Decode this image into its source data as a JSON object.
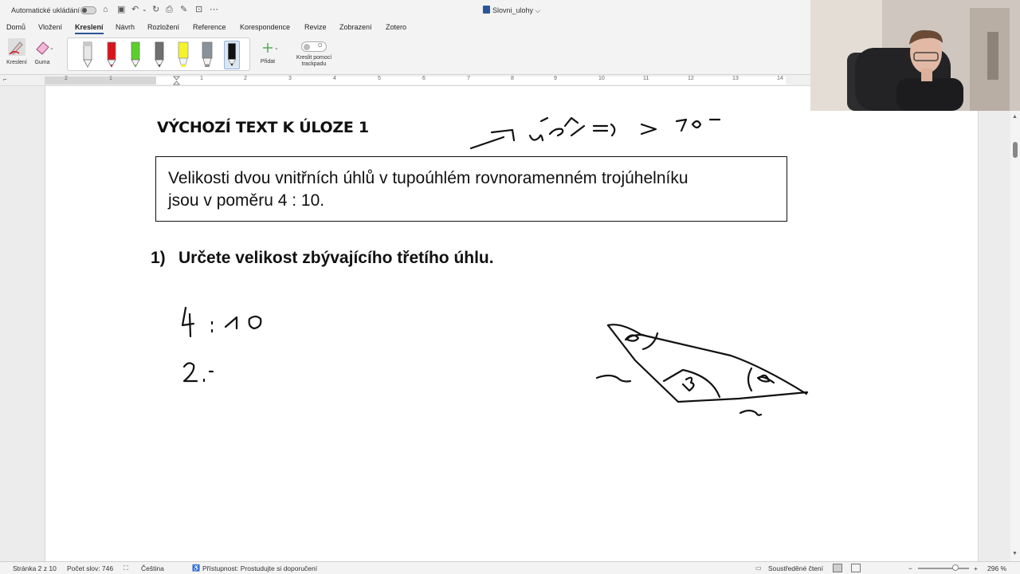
{
  "titlebar": {
    "autosave_label": "Automatické ukládání",
    "document_title": "Slovni_ulohy ⌵"
  },
  "tabs": [
    "Domů",
    "Vložení",
    "Kreslení",
    "Návrh",
    "Rozložení",
    "Reference",
    "Korespondence",
    "Revize",
    "Zobrazení",
    "Zotero"
  ],
  "active_tab": "Kreslení",
  "ribbon": {
    "draw_label": "Kreslení",
    "eraser_label": "Guma",
    "add_label": "Přidat",
    "trackpad_label_line1": "Kreslit pomocí",
    "trackpad_label_line2": "trackpadu",
    "trackpad_toggle_text": "O",
    "pens": [
      {
        "name": "gray-pen",
        "color": "#c8c8c8"
      },
      {
        "name": "red-pen",
        "color": "#d9151b"
      },
      {
        "name": "green-pen",
        "color": "#5ad129"
      },
      {
        "name": "dark-gray-pen",
        "color": "#707070"
      },
      {
        "name": "yellow-highlighter",
        "color": "#f6f32a"
      },
      {
        "name": "gray-highlighter",
        "color": "#8a9299"
      },
      {
        "name": "black-pen",
        "color": "#111111"
      }
    ]
  },
  "ruler": {
    "numbers": [
      "2",
      "1",
      "1",
      "2",
      "3",
      "4",
      "5",
      "6",
      "7",
      "8",
      "9",
      "10",
      "11",
      "12",
      "13",
      "14"
    ]
  },
  "document": {
    "heading": "VÝCHOZÍ TEXT K ÚLOZE 1",
    "box_line1": "Velikosti dvou vnitřních úhlů v tupoúhlém rovnoramenném trojúhelníku",
    "box_line2": "jsou v poměru 4 : 10.",
    "question_number": "1)",
    "question_text": "Určete velikost zbývajícího třetího úhlu."
  },
  "statusbar": {
    "page": "Stránka 2 z 10",
    "words": "Počet slov: 746",
    "language": "Čeština",
    "accessibility": "Přístupnost: Prostudujte si doporučení",
    "focus": "Soustředěné čtení",
    "zoom": "296 %"
  },
  "colors": {
    "accent": "#2b5797",
    "ink": "#111111"
  }
}
